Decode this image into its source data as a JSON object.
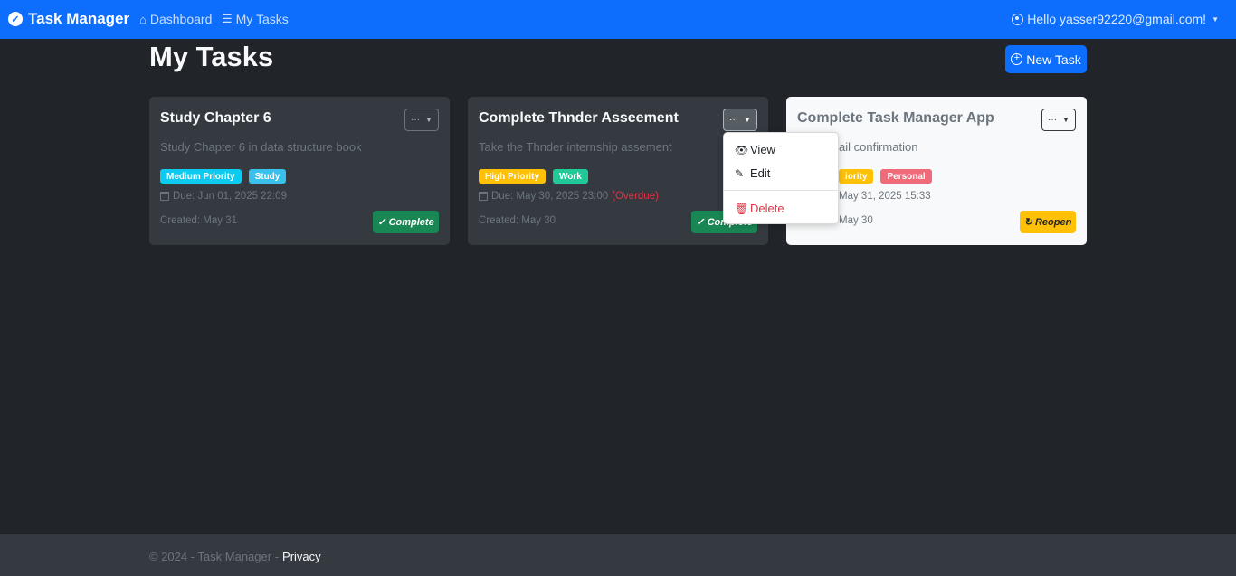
{
  "nav": {
    "brand": "Task Manager",
    "links": [
      {
        "label": "Dashboard",
        "icon": "house-icon"
      },
      {
        "label": "My Tasks",
        "icon": "list-icon"
      }
    ],
    "user_greeting": "Hello yasser92220@gmail.com!"
  },
  "page": {
    "title": "My Tasks",
    "new_task_label": "New Task"
  },
  "tasks": [
    {
      "title": "Study Chapter 6",
      "description": "Study Chapter 6 in data structure book",
      "priority": "Medium Priority",
      "category": "Study",
      "due": "Due: Jun 01, 2025 22:09",
      "overdue": "",
      "created": "Created: May 31",
      "action": "Complete",
      "completed": false
    },
    {
      "title": "Complete Thnder Asseement",
      "description": "Take the Thnder internship assement",
      "priority": "High Priority",
      "category": "Work",
      "due": "Due: May 30, 2025 23:00",
      "overdue": "(Overdue)",
      "created": "Created: May 30",
      "action": "Complete",
      "completed": false
    },
    {
      "title": "Complete Task Manager App",
      "description": "ail confirmation",
      "priority": "iority",
      "category": "Personal",
      "due": "May 31, 2025 15:33",
      "overdue": "",
      "created": "May 30",
      "action": "Reopen",
      "completed": true
    }
  ],
  "dropdown": {
    "view": "View",
    "edit": "Edit",
    "delete": "Delete"
  },
  "footer": {
    "text": "© 2024 - Task Manager -",
    "privacy": "Privacy"
  },
  "colors": {
    "primary": "#0d6efd",
    "success": "#198754",
    "warning": "#ffc107",
    "danger": "#dc3545",
    "info": "#0dcaf0"
  }
}
